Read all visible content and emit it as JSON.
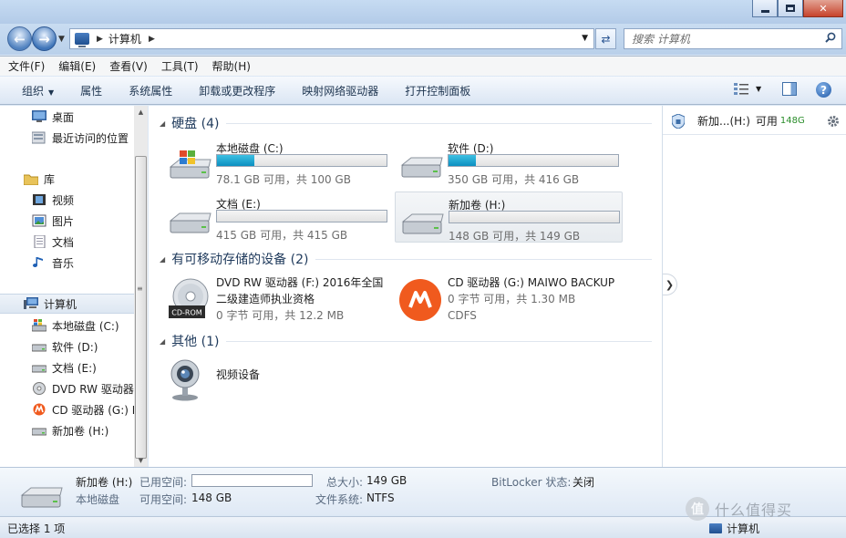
{
  "window": {
    "controls": {
      "minimize": "",
      "maximize": "",
      "close": "✕"
    }
  },
  "nav": {
    "address_path": "计算机",
    "search_placeholder": "搜索 计算机"
  },
  "menubar": [
    "文件(F)",
    "编辑(E)",
    "查看(V)",
    "工具(T)",
    "帮助(H)"
  ],
  "commandbar": {
    "items": [
      "组织",
      "属性",
      "系统属性",
      "卸载或更改程序",
      "映射网络驱动器",
      "打开控制面板"
    ]
  },
  "sidebar": {
    "items": [
      {
        "label": "桌面",
        "icon": "desktop-icon"
      },
      {
        "label": "最近访问的位置",
        "icon": "recent-places-icon"
      },
      {
        "label": "库",
        "icon": "library-icon"
      },
      {
        "label": "视频",
        "icon": "video-library-icon"
      },
      {
        "label": "图片",
        "icon": "pictures-library-icon"
      },
      {
        "label": "文档",
        "icon": "documents-library-icon"
      },
      {
        "label": "音乐",
        "icon": "music-library-icon"
      },
      {
        "label": "计算机",
        "icon": "computer-icon"
      },
      {
        "label": "本地磁盘 (C:)",
        "icon": "windows-drive-icon"
      },
      {
        "label": "软件 (D:)",
        "icon": "drive-icon"
      },
      {
        "label": "文档 (E:)",
        "icon": "drive-icon"
      },
      {
        "label": "DVD RW 驱动器",
        "icon": "dvd-drive-icon"
      },
      {
        "label": "CD 驱动器 (G:) M",
        "icon": "maiwo-drive-icon"
      },
      {
        "label": "新加卷 (H:)",
        "icon": "drive-icon"
      }
    ]
  },
  "groups": {
    "hdd": {
      "title": "硬盘 (4)"
    },
    "removable": {
      "title": "有可移动存储的设备 (2)"
    },
    "other": {
      "title": "其他 (1)"
    }
  },
  "drives": [
    {
      "name": "本地磁盘 (C:)",
      "space": "78.1 GB 可用，共 100 GB",
      "used_fraction": 0.22,
      "icon": "windows-drive-icon"
    },
    {
      "name": "软件 (D:)",
      "space": "350 GB 可用，共 416 GB",
      "used_fraction": 0.16,
      "icon": "drive-icon"
    },
    {
      "name": "文档 (E:)",
      "space": "415 GB 可用，共 415 GB",
      "used_fraction": 0.0,
      "icon": "drive-icon"
    },
    {
      "name": "新加卷 (H:)",
      "space": "148 GB 可用，共 149 GB",
      "used_fraction": 0.0,
      "icon": "drive-icon"
    }
  ],
  "devices": [
    {
      "name": "DVD RW 驱动器 (F:) 2016年全国二级建造师执业资格",
      "sub": "0 字节 可用，共 12.2 MB",
      "sub2": "",
      "icon": "cd-rom-icon"
    },
    {
      "name": "CD 驱动器 (G:) MAIWO BACKUP",
      "sub": "0 字节 可用，共 1.30 MB",
      "sub2": "CDFS",
      "icon": "maiwo-logo-icon"
    }
  ],
  "other": [
    {
      "name": "视频设备",
      "icon": "webcam-icon"
    }
  ],
  "preview": {
    "name": "新加...(H:)",
    "free_label": "可用",
    "free_value": "148G"
  },
  "details": {
    "name": "新加卷 (H:)",
    "type": "本地磁盘",
    "used_label": "已用空间:",
    "free_label": "可用空间:",
    "free_value": "148 GB",
    "total_label": "总大小:",
    "total_value": "149 GB",
    "fs_label": "文件系统:",
    "fs_value": "NTFS",
    "bitlocker_label": "BitLocker 状态:",
    "bitlocker_value": "关闭"
  },
  "status": {
    "selection": "已选择 1 项",
    "location": "计算机"
  },
  "watermark": {
    "logo": "值",
    "text": "什么值得买"
  },
  "colors": {
    "bar_fill": "#1a9fd0",
    "preview_free": "#2a8d2a"
  }
}
